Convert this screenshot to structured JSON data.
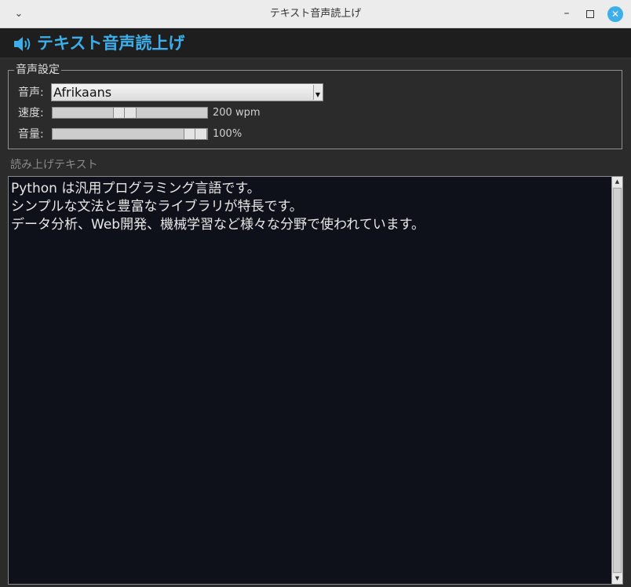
{
  "window": {
    "title": "テキスト音声読上げ",
    "menu_icon": "chevron-down-icon",
    "minimize_icon": "minimize-icon",
    "maximize_icon": "maximize-icon",
    "close_icon": "close-icon"
  },
  "header": {
    "title": "テキスト音声読上げ",
    "icon": "speaker-icon",
    "accent_color": "#3daee9"
  },
  "settings": {
    "legend": "音声設定",
    "voice_label": "音声:",
    "voice_value": "Afrikaans",
    "speed_label": "速度:",
    "speed_value": "200 wpm",
    "speed_fraction": 0.46,
    "volume_label": "音量:",
    "volume_value": "100%",
    "volume_fraction": 1.0
  },
  "text_section": {
    "label": "読み上げテキスト",
    "lines": [
      "Python は汎用プログラミング言語です。",
      "シンプルな文法と豊富なライブラリが特長です。",
      "データ分析、Web開発、機械学習など様々な分野で使われています。"
    ]
  }
}
